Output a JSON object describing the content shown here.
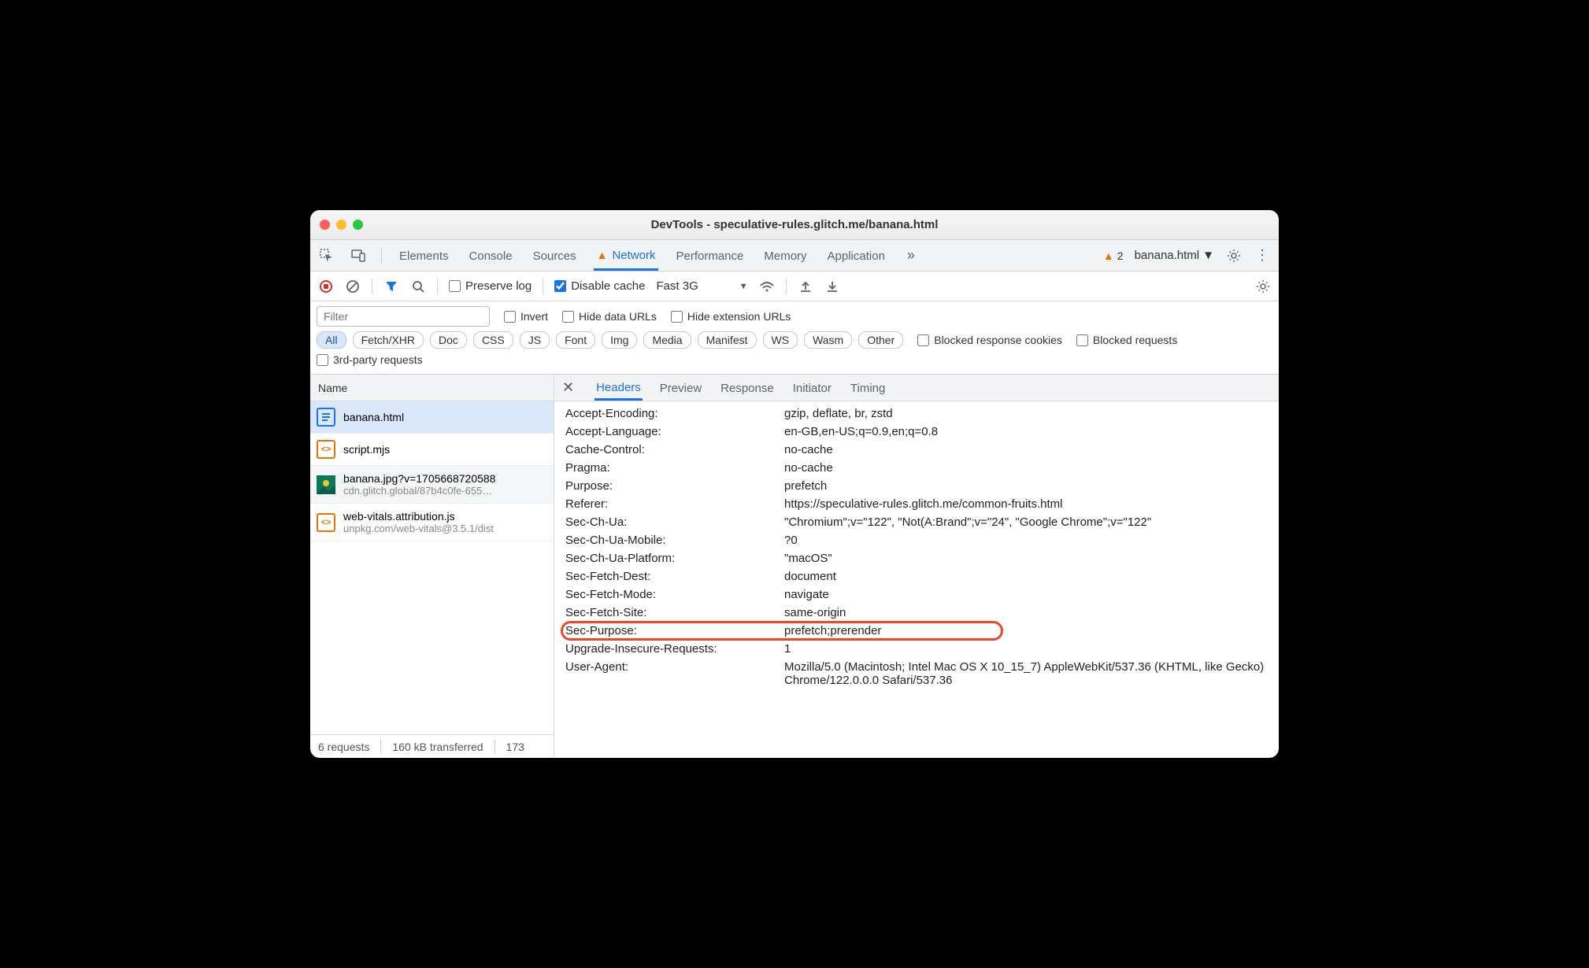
{
  "window": {
    "title": "DevTools - speculative-rules.glitch.me/banana.html"
  },
  "main_tabs": {
    "items": [
      "Elements",
      "Console",
      "Sources",
      "Network",
      "Performance",
      "Memory",
      "Application"
    ],
    "active": "Network",
    "warning_count": "2",
    "context": "banana.html"
  },
  "net_toolbar": {
    "preserve_log": "Preserve log",
    "disable_cache": "Disable cache",
    "throttle": "Fast 3G"
  },
  "filter": {
    "placeholder": "Filter",
    "invert": "Invert",
    "hide_data": "Hide data URLs",
    "hide_ext": "Hide extension URLs",
    "types": [
      "All",
      "Fetch/XHR",
      "Doc",
      "CSS",
      "JS",
      "Font",
      "Img",
      "Media",
      "Manifest",
      "WS",
      "Wasm",
      "Other"
    ],
    "blocked_cookies": "Blocked response cookies",
    "blocked_req": "Blocked requests",
    "third_party": "3rd-party requests"
  },
  "requests_header": "Name",
  "requests": [
    {
      "name": "banana.html",
      "sub": "",
      "kind": "doc"
    },
    {
      "name": "script.mjs",
      "sub": "",
      "kind": "js"
    },
    {
      "name": "banana.jpg?v=1705668720588",
      "sub": "cdn.glitch.global/87b4c0fe-655…",
      "kind": "img"
    },
    {
      "name": "web-vitals.attribution.js",
      "sub": "unpkg.com/web-vitals@3.5.1/dist",
      "kind": "js"
    }
  ],
  "status": {
    "requests": "6 requests",
    "transferred": "160 kB transferred",
    "trunc": "173"
  },
  "detail_tabs": [
    "Headers",
    "Preview",
    "Response",
    "Initiator",
    "Timing"
  ],
  "headers": [
    {
      "k": "Accept-Encoding:",
      "v": "gzip, deflate, br, zstd"
    },
    {
      "k": "Accept-Language:",
      "v": "en-GB,en-US;q=0.9,en;q=0.8"
    },
    {
      "k": "Cache-Control:",
      "v": "no-cache"
    },
    {
      "k": "Pragma:",
      "v": "no-cache"
    },
    {
      "k": "Purpose:",
      "v": "prefetch"
    },
    {
      "k": "Referer:",
      "v": "https://speculative-rules.glitch.me/common-fruits.html"
    },
    {
      "k": "Sec-Ch-Ua:",
      "v": "\"Chromium\";v=\"122\", \"Not(A:Brand\";v=\"24\", \"Google Chrome\";v=\"122\""
    },
    {
      "k": "Sec-Ch-Ua-Mobile:",
      "v": "?0"
    },
    {
      "k": "Sec-Ch-Ua-Platform:",
      "v": "\"macOS\""
    },
    {
      "k": "Sec-Fetch-Dest:",
      "v": "document"
    },
    {
      "k": "Sec-Fetch-Mode:",
      "v": "navigate"
    },
    {
      "k": "Sec-Fetch-Site:",
      "v": "same-origin"
    },
    {
      "k": "Sec-Purpose:",
      "v": "prefetch;prerender",
      "hl": true
    },
    {
      "k": "Upgrade-Insecure-Requests:",
      "v": "1"
    },
    {
      "k": "User-Agent:",
      "v": "Mozilla/5.0 (Macintosh; Intel Mac OS X 10_15_7) AppleWebKit/537.36 (KHTML, like Gecko) Chrome/122.0.0.0 Safari/537.36"
    }
  ]
}
